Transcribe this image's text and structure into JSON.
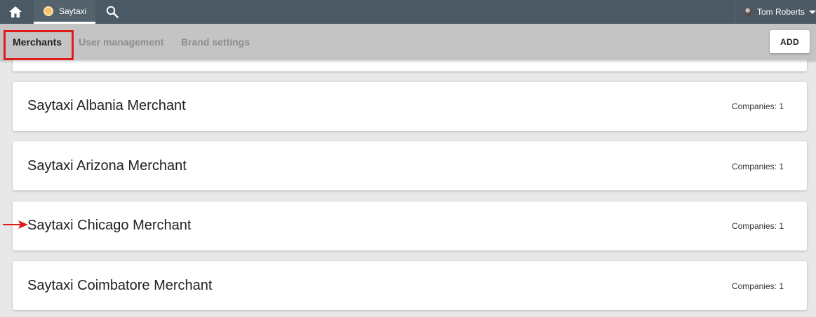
{
  "topbar": {
    "tab_label": "Saytaxi",
    "user_name": "Tom Roberts"
  },
  "subnav": {
    "tabs": [
      {
        "label": "Merchants",
        "active": true
      },
      {
        "label": "User management",
        "active": false
      },
      {
        "label": "Brand settings",
        "active": false
      }
    ],
    "add_label": "ADD"
  },
  "merchants": [
    {
      "name": "Saytaxi Albania Merchant",
      "companies": "Companies: 1"
    },
    {
      "name": "Saytaxi Arizona Merchant",
      "companies": "Companies: 1"
    },
    {
      "name": "Saytaxi Chicago Merchant",
      "companies": "Companies: 1"
    },
    {
      "name": "Saytaxi Coimbatore Merchant",
      "companies": "Companies: 1"
    }
  ],
  "icons": {
    "home": "home-icon",
    "search": "search-icon",
    "user": "avatar",
    "dropdown": "caret-down-icon",
    "annotation": "red-arrow-icon"
  },
  "colors": {
    "topbar": "#4a5964",
    "subbar": "#c4c4c4",
    "highlight": "#e01b1b",
    "background": "#e8e8e8"
  }
}
